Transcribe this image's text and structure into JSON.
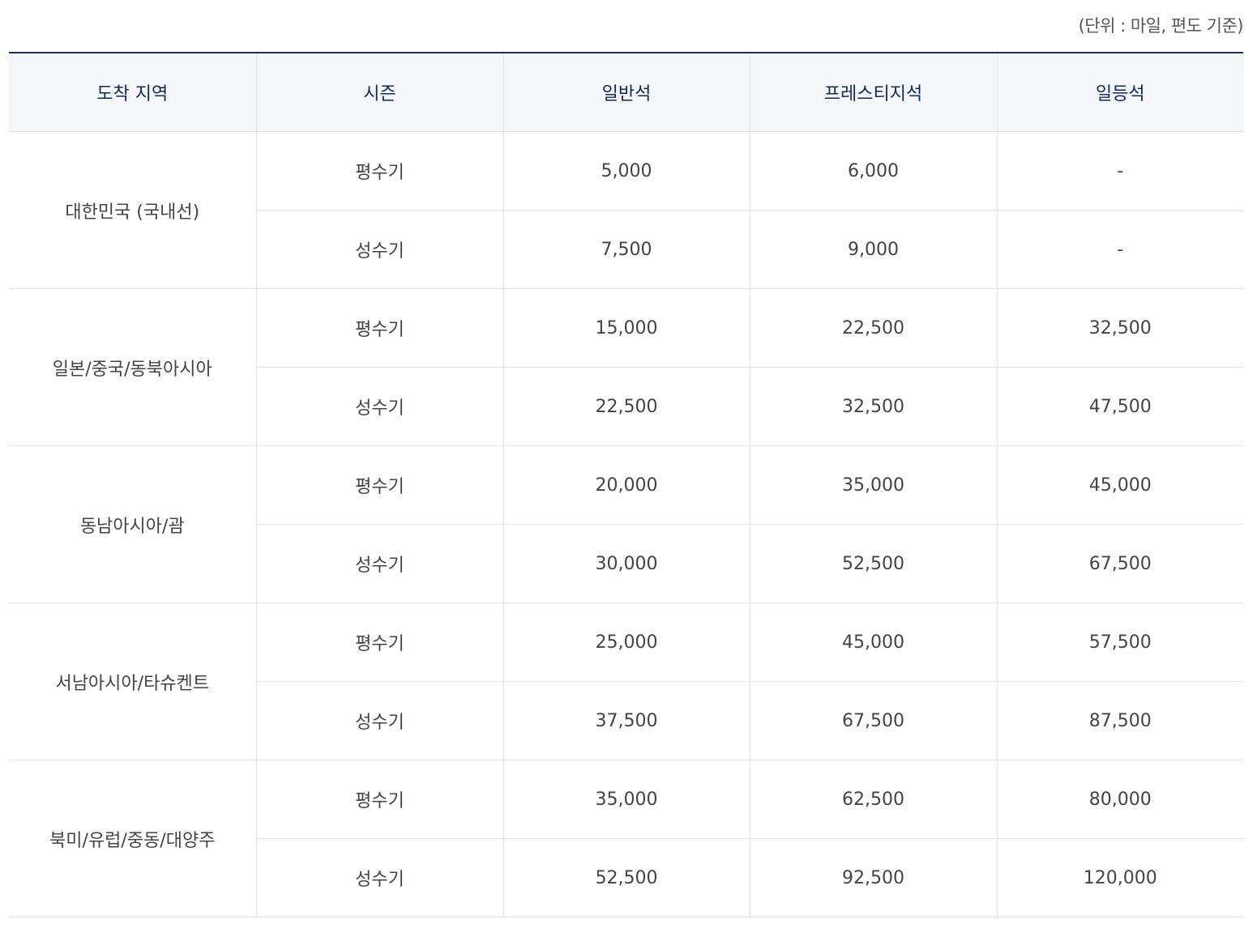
{
  "unit_note": "(단위 : 마일, 편도 기준)",
  "headers": {
    "region": "도착 지역",
    "season": "시즌",
    "economy": "일반석",
    "prestige": "프레스티지석",
    "first": "일등석"
  },
  "rows": [
    {
      "region": "대한민국 (국내선)",
      "low": {
        "season": "평수기",
        "economy": "5,000",
        "prestige": "6,000",
        "first": "-"
      },
      "peak": {
        "season": "성수기",
        "economy": "7,500",
        "prestige": "9,000",
        "first": "-"
      }
    },
    {
      "region": "일본/중국/동북아시아",
      "low": {
        "season": "평수기",
        "economy": "15,000",
        "prestige": "22,500",
        "first": "32,500"
      },
      "peak": {
        "season": "성수기",
        "economy": "22,500",
        "prestige": "32,500",
        "first": "47,500"
      }
    },
    {
      "region": "동남아시아/괌",
      "low": {
        "season": "평수기",
        "economy": "20,000",
        "prestige": "35,000",
        "first": "45,000"
      },
      "peak": {
        "season": "성수기",
        "economy": "30,000",
        "prestige": "52,500",
        "first": "67,500"
      }
    },
    {
      "region": "서남아시아/타슈켄트",
      "low": {
        "season": "평수기",
        "economy": "25,000",
        "prestige": "45,000",
        "first": "57,500"
      },
      "peak": {
        "season": "성수기",
        "economy": "37,500",
        "prestige": "67,500",
        "first": "87,500"
      }
    },
    {
      "region": "북미/유럽/중동/대양주",
      "low": {
        "season": "평수기",
        "economy": "35,000",
        "prestige": "62,500",
        "first": "80,000"
      },
      "peak": {
        "season": "성수기",
        "economy": "52,500",
        "prestige": "92,500",
        "first": "120,000"
      }
    }
  ]
}
